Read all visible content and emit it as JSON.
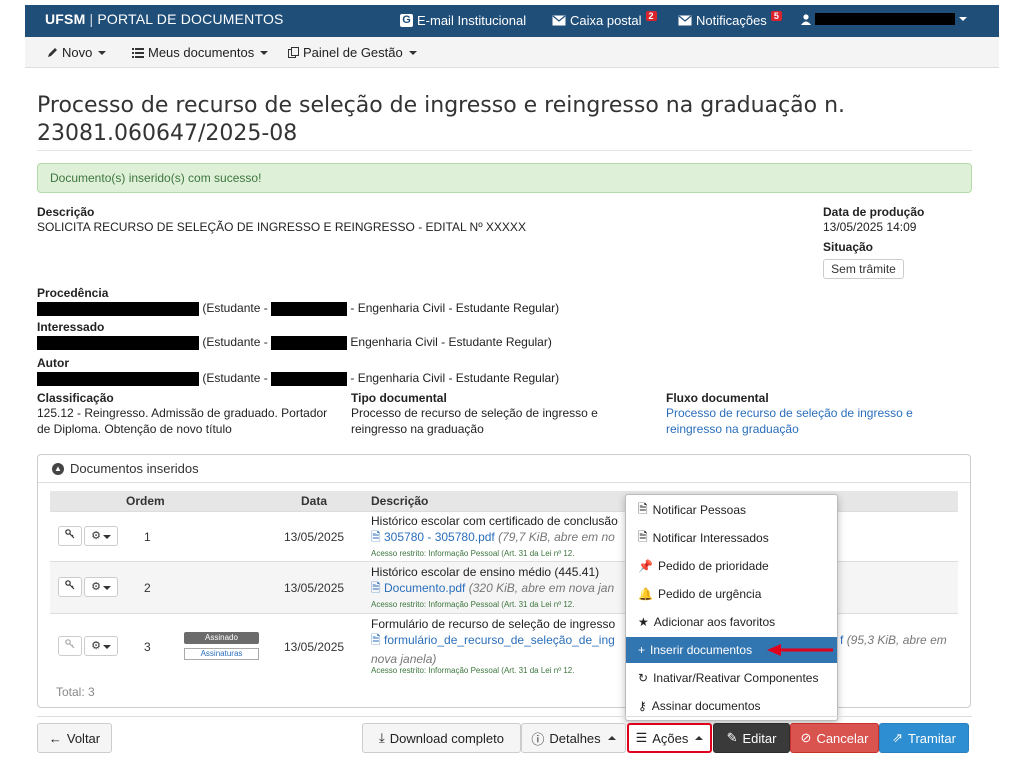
{
  "header": {
    "brand_bold": "UFSM",
    "brand_sep": "|",
    "brand_text": "PORTAL DE DOCUMENTOS",
    "email_icon": "G",
    "email_label": "E-mail Institucional",
    "inbox_label": "Caixa postal",
    "inbox_count": "2",
    "notif_label": "Notificações",
    "notif_count": "5"
  },
  "subnav": {
    "new": "Novo",
    "my_docs": "Meus documentos",
    "panel": "Painel de Gestão"
  },
  "page": {
    "title": "Processo de recurso de seleção de ingresso e reingresso na graduação n. 23081.060647/2025-08",
    "alert": "Documento(s) inserido(s) com sucesso!"
  },
  "details": {
    "descricao_label": "Descrição",
    "descricao_value": "SOLICITA RECURSO DE SELEÇÃO DE INGRESSO E REINGRESSO - EDITAL Nº XXXXX",
    "data_label": "Data de produção",
    "data_value": "13/05/2025 14:09",
    "situacao_label": "Situação",
    "situacao_value": "Sem trâmite",
    "procedencia_label": "Procedência",
    "procedencia_a": "(Estudante -",
    "procedencia_b": "- Engenharia Civil - Estudante Regular)",
    "interessado_label": "Interessado",
    "interessado_a": "(Estudante -",
    "interessado_b": "Engenharia Civil - Estudante Regular)",
    "autor_label": "Autor",
    "autor_a": "(Estudante -",
    "autor_b": "- Engenharia Civil - Estudante Regular)",
    "classificacao_label": "Classificação",
    "classificacao_value_1": "125.12 - Reingresso. Admissão de graduado. Portador",
    "classificacao_value_2": "de Diploma. Obtenção de novo título",
    "tipo_label": "Tipo documental",
    "tipo_value_1": "Processo de recurso de seleção de ingresso e",
    "tipo_value_2": "reingresso na graduação",
    "fluxo_label": "Fluxo documental",
    "fluxo_value_1": "Processo de recurso de seleção de ingresso e",
    "fluxo_value_2": "reingresso na graduação"
  },
  "documents": {
    "panel_title": "Documentos inseridos",
    "col_ordem": "Ordem",
    "col_data": "Data",
    "col_descricao": "Descrição",
    "rows": [
      {
        "ordem": "1",
        "data": "13/05/2025",
        "title": "Histórico escolar com certificado de conclusão",
        "file": "305780 - 305780.pdf",
        "file_meta": "(79,7 KiB, abre em no",
        "restr": "Acesso restrito: Informação Pessoal (Art. 31 da Lei nº 12."
      },
      {
        "ordem": "2",
        "data": "13/05/2025",
        "title": "Histórico escolar de ensino médio (445.41)",
        "file": "Documento.pdf",
        "file_meta": "(320 KiB, abre em nova jan",
        "restr": "Acesso restrito: Informação Pessoal (Art. 31 da Lei nº 12."
      },
      {
        "ordem": "3",
        "data": "13/05/2025",
        "title": "Formulário de recurso de seleção de ingresso",
        "file": "formulário_de_recurso_de_seleção_de_ing",
        "file_tail": "f",
        "file_meta": "(95,3 KiB, abre em",
        "file_meta2": "nova janela)",
        "restr": "Acesso restrito: Informação Pessoal (Art. 31 da Lei nº 12.",
        "signed": "Assinado",
        "signatures": "Assinaturas"
      }
    ],
    "total": "Total: 3"
  },
  "actions_menu": {
    "items": [
      "Notificar Pessoas",
      "Notificar Interessados",
      "Pedido de prioridade",
      "Pedido de urgência",
      "Adicionar aos favoritos",
      "Inserir documentos",
      "Inativar/Reativar Componentes",
      "Assinar documentos"
    ],
    "active_index": 5
  },
  "footer": {
    "back": "Voltar",
    "download": "Download completo",
    "details": "Detalhes",
    "actions": "Ações",
    "edit": "Editar",
    "cancel": "Cancelar",
    "send": "Tramitar"
  },
  "colors": {
    "topbar": "#1f4e79",
    "success_bg": "#dff0d8",
    "link": "#2a6ebb",
    "menu_active": "#3276b1",
    "annotation": "#e0001b"
  }
}
